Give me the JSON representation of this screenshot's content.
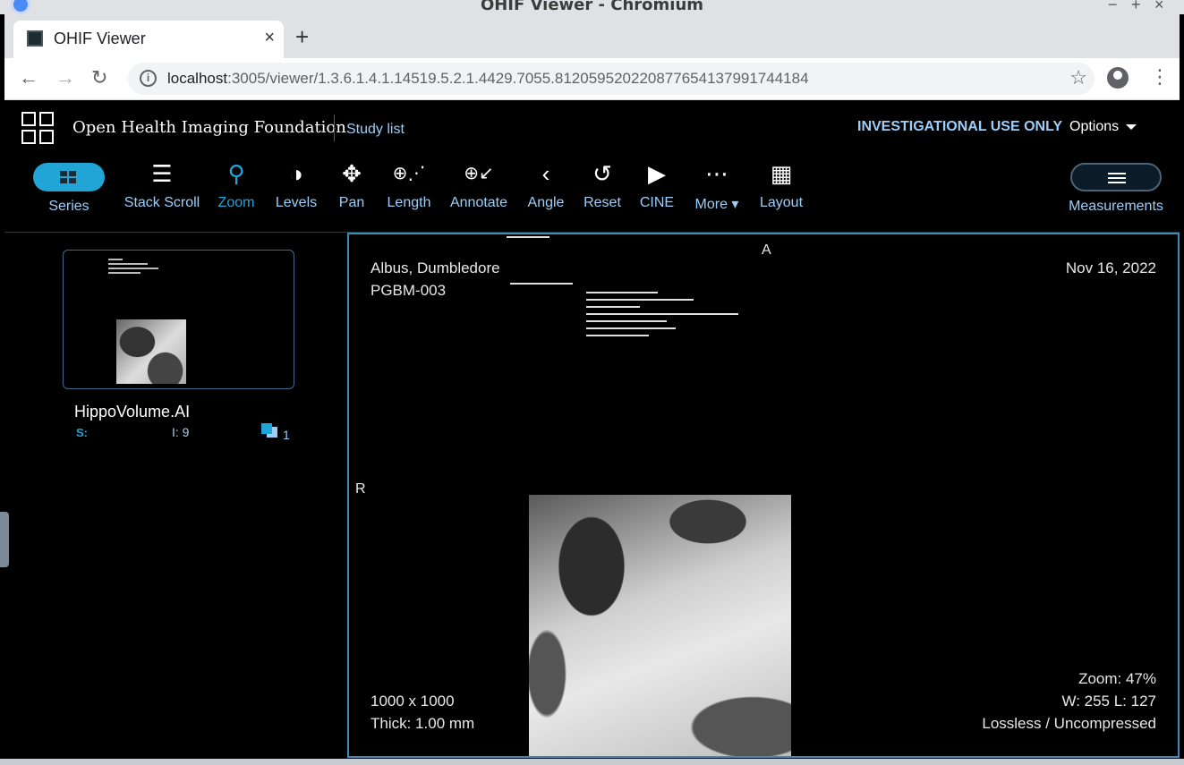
{
  "window": {
    "title": "OHIF Viewer - Chromium",
    "minimize": "−",
    "maximize": "+",
    "close": "×"
  },
  "tab": {
    "title": "OHIF Viewer",
    "close": "×",
    "new_tab": "+"
  },
  "address": {
    "host": "localhost",
    "path": ":3005/viewer/1.3.6.1.4.1.14519.5.2.1.4429.7055.812059520220877654137991744184"
  },
  "header": {
    "brand": "Open Health Imaging Foundation",
    "study_list": "Study list",
    "notice": "INVESTIGATIONAL USE ONLY",
    "options": "Options"
  },
  "toolbar": {
    "series": "Series",
    "tools": [
      {
        "label": "Stack Scroll",
        "icon": "bars-icon"
      },
      {
        "label": "Zoom",
        "icon": "search-icon"
      },
      {
        "label": "Levels",
        "icon": "contrast-icon"
      },
      {
        "label": "Pan",
        "icon": "move-icon"
      },
      {
        "label": "Length",
        "icon": "ruler-icon"
      },
      {
        "label": "Annotate",
        "icon": "arrow-annotate-icon"
      },
      {
        "label": "Angle",
        "icon": "angle-icon"
      },
      {
        "label": "Reset",
        "icon": "reset-icon"
      },
      {
        "label": "CINE",
        "icon": "play-icon"
      },
      {
        "label": "More",
        "icon": "more-icon"
      },
      {
        "label": "Layout",
        "icon": "grid-icon"
      }
    ],
    "measurements": "Measurements"
  },
  "series_panel": {
    "name": "HippoVolume.AI",
    "s_label": "S:",
    "i_label": "I: 9",
    "count": "1"
  },
  "viewport": {
    "patient_name": "Albus, Dumbledore",
    "patient_id": "PGBM-003",
    "date": "Nov 16, 2022",
    "orientation_top": "A",
    "orientation_left": "R",
    "dimensions": "1000 x 1000",
    "thickness": "Thick: 1.00 mm",
    "zoom": "Zoom: 47%",
    "wl": "W: 255 L: 127",
    "compression": "Lossless / Uncompressed"
  },
  "colors": {
    "accent": "#20a5d6",
    "text_blue": "#9ccef9",
    "viewport_border": "#3d8bb8"
  }
}
